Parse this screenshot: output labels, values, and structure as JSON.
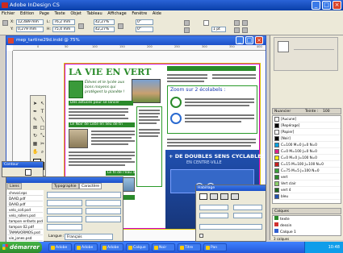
{
  "app": {
    "title": "Adobe InDesign CS"
  },
  "menu": [
    "Fichier",
    "Edition",
    "Page",
    "Texte",
    "Objet",
    "Tableau",
    "Affichage",
    "Fenêtre",
    "Aide"
  ],
  "control_panel": {
    "x_label": "X:",
    "x_value": "12,489 mm",
    "y_label": "Y:",
    "y_value": "0,279 mm",
    "w_label": "L:",
    "w_value": "76,2 mm",
    "h_label": "H:",
    "h_value": "75,4 mm",
    "scale_x": "42,27%",
    "scale_y": "42,27%",
    "rotation": "0°",
    "shear": "0°",
    "stroke": "1 pt"
  },
  "document": {
    "title": "mep_tartine29d.indd @ 75%",
    "ruler_marks": [
      "0",
      "50",
      "100",
      "150",
      "200",
      "250",
      "300",
      "350",
      "400"
    ]
  },
  "page_content": {
    "headline": "LA VIE EN VERT",
    "intro": "Élèves et le lycée aux bons moyens qui protègent la planète !",
    "box_title_1": "Des astuces pour se lancer",
    "box_title_2": "Zoom sur 2 écolabels :",
    "box_title_3": "Le Noir de Liste en lieu de tri",
    "box_title_4": "Le fil de l'eau à pas",
    "box_title_5": "Des bons gestes",
    "cycle_heading": "+ DE DOUBLES SENS CYCLABLES",
    "cycle_sub": "EN CENTRE-VILLE"
  },
  "links_panel": {
    "title": "Liens",
    "tabs": [
      "Liens",
      "Typographie",
      "Caractère"
    ],
    "files": [
      "cheval.eps",
      "DAAD.pdf",
      "DAAD.pdf",
      "velo_coll.psd",
      "velo_rollers.psd",
      "tampon enfants.psd",
      "tampon 02.pdf",
      "TAMAVORMOS.psd",
      "vie_jones.psd"
    ],
    "language_label": "Langue :",
    "language_value": "Français"
  },
  "contour_panel": {
    "title": "Contour",
    "tab": "Habillage"
  },
  "swatches_panel": {
    "tab": "Nuancier",
    "tint_label": "Teinte :",
    "tint_value": "100",
    "items": [
      "[Aucune]",
      "[Repérage]",
      "[Papier]",
      "[Noir]",
      "C=100 M=0 J=0 N=0",
      "C=0 M=100 J=0 N=0",
      "C=0 M=0 J=100 N=0",
      "C=15 M=100 J=100 N=0",
      "C=75 M=5 J=100 N=0",
      "vert",
      "Vert clair",
      "vert 4",
      "bleu"
    ]
  },
  "layers_panel": {
    "tab": "Calques",
    "items": [
      "texte",
      "dessin",
      "Calque 1"
    ],
    "count": "3 calques"
  },
  "taskbar": {
    "start_label": "démarrer",
    "items": [
      "Adobe",
      "Adobe",
      "Adobe",
      "Calque",
      "Noir",
      "Titre",
      "Pan"
    ],
    "clock": "10:48"
  },
  "colors": {
    "xp_blue": "#2a63d7",
    "headline_green": "#2a8a2a",
    "cycle_blue": "#1f4aa0",
    "start_green": "#3c9b3c"
  }
}
